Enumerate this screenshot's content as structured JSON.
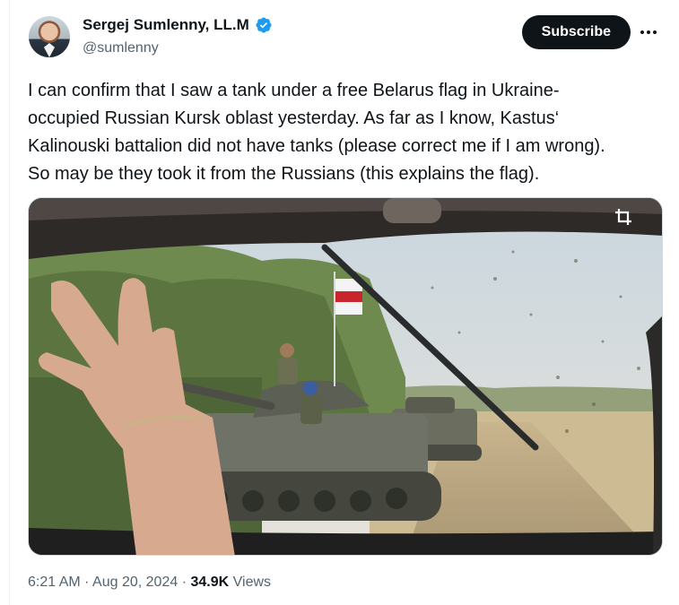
{
  "author": {
    "display_name": "Sergej Sumlenny, LL.M",
    "handle": "@sumlenny"
  },
  "actions": {
    "subscribe_label": "Subscribe"
  },
  "tweet": {
    "text": "I can confirm that I saw a tank under a free Belarus flag in Ukraine-\noccupied Russian Kursk oblast yesterday. As far as I know, Kastus‘\nKalinouski battalion did not have tanks (please correct me if I am wrong).\nSo may be they took it from the Russians (this explains the flag)."
  },
  "meta": {
    "time": "6:21 AM",
    "date": "Aug 20, 2024",
    "views_count": "34.9K",
    "views_label": "Views",
    "separator": "·"
  },
  "colors": {
    "accent": "#1d9bf0",
    "text": "#0f1419",
    "secondary_text": "#536471",
    "button_bg": "#0f1419"
  },
  "icons": {
    "verified": "verified-badge-icon",
    "more": "more-dots-icon",
    "crop": "crop-icon"
  }
}
